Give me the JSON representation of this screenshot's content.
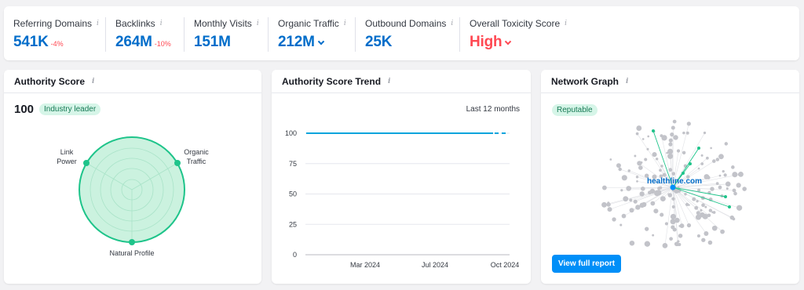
{
  "metrics": [
    {
      "label": "Referring Domains",
      "value": "541K",
      "delta": "-4%"
    },
    {
      "label": "Backlinks",
      "value": "264M",
      "delta": "-10%"
    },
    {
      "label": "Monthly Visits",
      "value": "151M"
    },
    {
      "label": "Organic Traffic",
      "value": "212M"
    },
    {
      "label": "Outbound Domains",
      "value": "25K"
    },
    {
      "label": "Overall Toxicity Score",
      "value": "High"
    }
  ],
  "authority": {
    "title": "Authority Score",
    "score": "100",
    "badge": "Industry leader",
    "radar": {
      "labels": [
        "Link\nPower",
        "Organic\nTraffic",
        "Natural Profile"
      ]
    }
  },
  "trend": {
    "title": "Authority Score Trend",
    "period": "Last 12 months"
  },
  "network": {
    "title": "Network Graph",
    "badge": "Reputable",
    "domain": "healthline.com",
    "button": "View full report"
  },
  "chart_data": {
    "type": "line",
    "title": "Authority Score Trend",
    "x_ticks": [
      "Mar 2024",
      "Jul 2024",
      "Oct 2024"
    ],
    "y_ticks": [
      0,
      25,
      50,
      75,
      100
    ],
    "ylim": [
      0,
      100
    ],
    "series": [
      {
        "values": [
          100,
          100,
          100,
          100,
          100,
          100,
          100,
          100,
          100,
          100,
          100,
          100
        ]
      }
    ],
    "grid": true,
    "colors": {
      "line": "#00a4dd"
    }
  },
  "icons": [
    "info-icon",
    "chevron-down-icon"
  ],
  "colors": {
    "link_blue": "#006dca",
    "danger": "#ff4953",
    "accent_green": "#1ec48a",
    "button": "#008ff8"
  }
}
